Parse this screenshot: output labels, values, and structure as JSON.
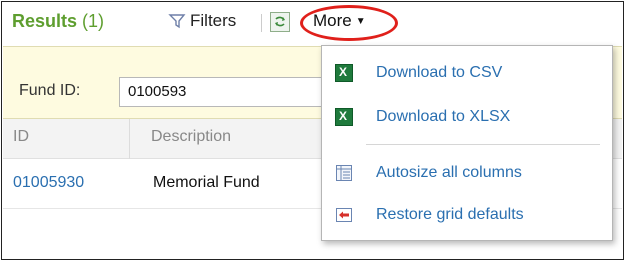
{
  "toolbar": {
    "results_label": "Results",
    "results_count": "(1)",
    "filters_label": "Filters",
    "more_label": "More"
  },
  "filter": {
    "fund_label": "Fund ID:",
    "fund_value": "0100593"
  },
  "grid": {
    "columns": [
      "ID",
      "Description"
    ],
    "rows": [
      {
        "id": "01005930",
        "description": "Memorial Fund"
      }
    ]
  },
  "menu": {
    "items": [
      {
        "label": "Download to CSV",
        "icon": "excel-icon"
      },
      {
        "label": "Download to XLSX",
        "icon": "excel-icon"
      },
      {
        "label": "Autosize all columns",
        "icon": "columns-icon"
      },
      {
        "label": "Restore grid defaults",
        "icon": "restore-icon"
      }
    ]
  },
  "colors": {
    "accent_green": "#5e9e2f",
    "link_blue": "#2a6fb0",
    "highlight_red": "#e0201b",
    "filter_band": "#fefbe0"
  }
}
